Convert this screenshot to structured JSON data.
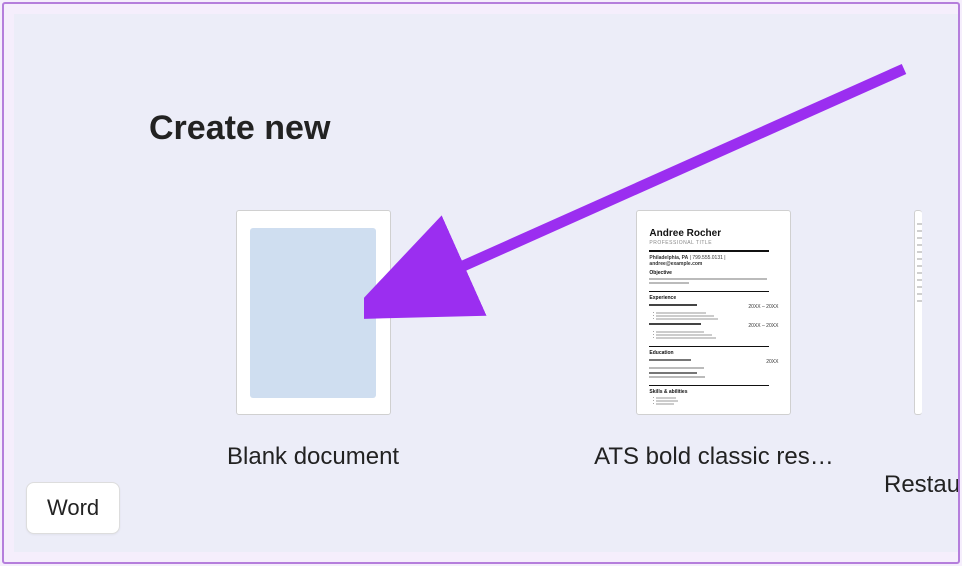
{
  "section_title": "Create new",
  "templates": [
    {
      "label": "Blank document"
    },
    {
      "label": "ATS bold classic res…"
    },
    {
      "label": "Restau"
    }
  ],
  "resume_preview": {
    "name": "Andree Rocher",
    "subtitle": "PROFESSIONAL TITLE",
    "contact_city": "Philadelphia, PA",
    "contact_phone": "799.555.0131",
    "contact_email": "andree@example.com",
    "objective_label": "Objective",
    "experience_label": "Experience",
    "education_label": "Education",
    "skills_label": "Skills & abilities",
    "date1": "20XX – 20XX",
    "date2": "20XX – 20XX",
    "edu_year": "20XX"
  },
  "tab_label": "Word",
  "colors": {
    "annotation": "#9b2ef0",
    "panel_bg": "#ecedf8",
    "blank_fill": "#cfdef0",
    "border": "#b57edc"
  }
}
